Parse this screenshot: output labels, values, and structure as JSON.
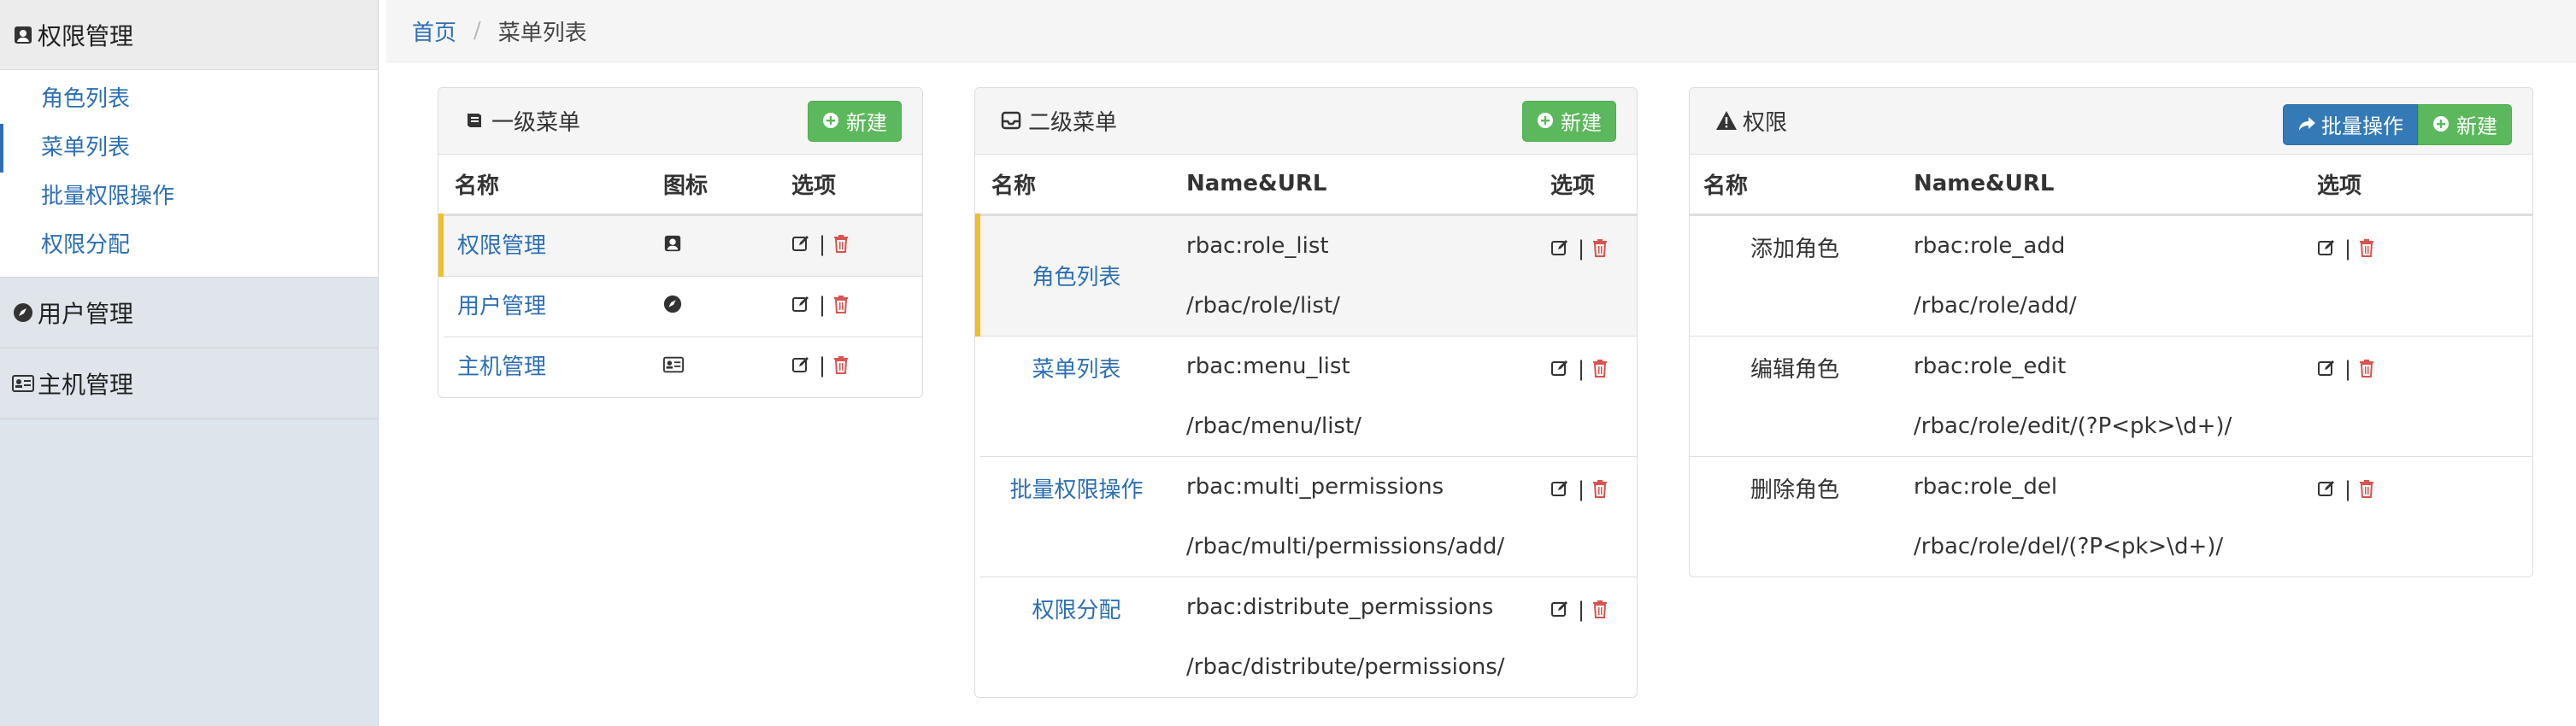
{
  "sidebar": {
    "groups": [
      {
        "title": "权限管理",
        "icon": "user-badge-icon",
        "items": [
          {
            "label": "角色列表"
          },
          {
            "label": "菜单列表"
          },
          {
            "label": "批量权限操作"
          },
          {
            "label": "权限分配"
          }
        ]
      },
      {
        "title": "用户管理",
        "icon": "compass-icon"
      },
      {
        "title": "主机管理",
        "icon": "id-card-icon"
      }
    ],
    "active_item": "菜单列表"
  },
  "breadcrumb": {
    "home": "首页",
    "separator": "/",
    "current": "菜单列表"
  },
  "panels": {
    "level1": {
      "title": "一级菜单",
      "icon": "book-icon",
      "new_label": "新建",
      "columns": [
        "名称",
        "图标",
        "选项"
      ],
      "rows": [
        {
          "name": "权限管理",
          "icon": "user-badge-icon",
          "selected": true
        },
        {
          "name": "用户管理",
          "icon": "compass-icon",
          "selected": false
        },
        {
          "name": "主机管理",
          "icon": "id-card-icon",
          "selected": false
        }
      ]
    },
    "level2": {
      "title": "二级菜单",
      "icon": "inbox-icon",
      "new_label": "新建",
      "columns": [
        "名称",
        "Name&URL",
        "选项"
      ],
      "rows": [
        {
          "name": "角色列表",
          "code": "rbac:role_list",
          "url": "/rbac/role/list/",
          "selected": true
        },
        {
          "name": "菜单列表",
          "code": "rbac:menu_list",
          "url": "/rbac/menu/list/",
          "selected": false
        },
        {
          "name": "批量权限操作",
          "code": "rbac:multi_permissions",
          "url": "/rbac/multi/permissions/add/",
          "selected": false
        },
        {
          "name": "权限分配",
          "code": "rbac:distribute_permissions",
          "url": "/rbac/distribute/permissions/",
          "selected": false
        }
      ]
    },
    "perms": {
      "title": "权限",
      "icon": "warning-icon",
      "batch_label": "批量操作",
      "new_label": "新建",
      "columns": [
        "名称",
        "Name&URL",
        "选项"
      ],
      "rows": [
        {
          "name": "添加角色",
          "code": "rbac:role_add",
          "url": "/rbac/role/add/"
        },
        {
          "name": "编辑角色",
          "code": "rbac:role_edit",
          "url": "/rbac/role/edit/(?P<pk>\\d+)/"
        },
        {
          "name": "删除角色",
          "code": "rbac:role_del",
          "url": "/rbac/role/del/(?P<pk>\\d+)/"
        }
      ]
    }
  },
  "ops_separator": "|",
  "colors": {
    "link": "#2c6fb3",
    "success": "#5cb85c",
    "primary": "#337ab7",
    "highlight": "#f0c024",
    "danger": "#d9534f"
  }
}
